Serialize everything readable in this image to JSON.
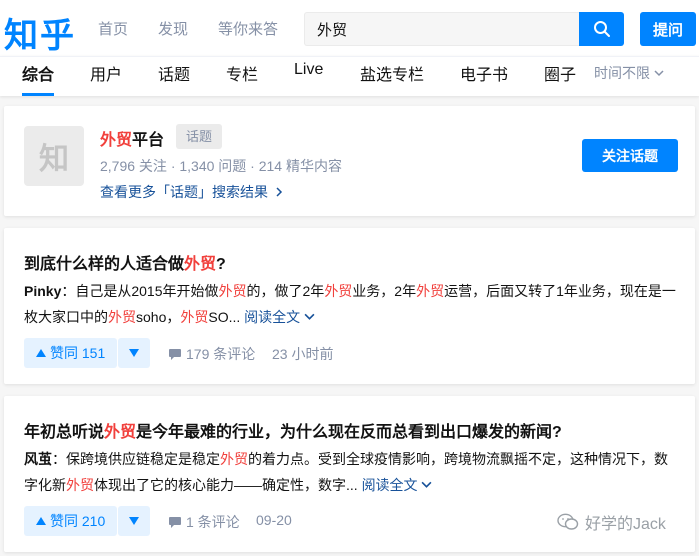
{
  "header": {
    "logo": "知乎",
    "nav": [
      "首页",
      "发现",
      "等你来答"
    ],
    "search_value": "外贸",
    "ask_label": "提问"
  },
  "tabs": {
    "items": [
      "综合",
      "用户",
      "话题",
      "专栏",
      "Live",
      "盐选专栏",
      "电子书",
      "圈子"
    ],
    "active": "综合",
    "time_filter": "时间不限"
  },
  "topic": {
    "avatar_text": "知",
    "name_highlight": "外贸",
    "name_rest": "平台",
    "tag": "话题",
    "stats": "2,796 关注 · 1,340 问题 · 214 精华内容",
    "more_link": "查看更多「话题」搜索结果"
  },
  "answers": [
    {
      "title_pre": "到底什么样的人适合做",
      "title_hl": "外贸",
      "title_post": "?",
      "author": "Pinky",
      "excerpt_parts": [
        "：自己是从2015年开始做",
        "外贸",
        "的，做了2年",
        "外贸",
        "业务，2年",
        "外贸",
        "运营，后面又转了1年业务，现在是一枚大家口中的",
        "外贸",
        "soho，",
        "外贸",
        "SO..."
      ],
      "read_more": "阅读全文",
      "votes": "赞同 151",
      "comments": "179 条评论",
      "time": "23 小时前"
    },
    {
      "title_pre": "年初总听说",
      "title_hl": "外贸",
      "title_post": "是今年最难的行业，为什么现在反而总看到出口爆发的新闻?",
      "author": "风茧",
      "excerpt_parts": [
        "：保跨境供应链稳定是稳定",
        "外贸",
        "的着力点。受到全球疫情影响，跨境物流飘摇不定，这种情况下，数字化新",
        "外贸",
        "体现出了它的核心能力——确定性，数字..."
      ],
      "read_more": "阅读全文",
      "votes": "赞同 210",
      "comments": "1 条评论",
      "time": "09-20"
    }
  ],
  "watermark": "好学的Jack"
}
